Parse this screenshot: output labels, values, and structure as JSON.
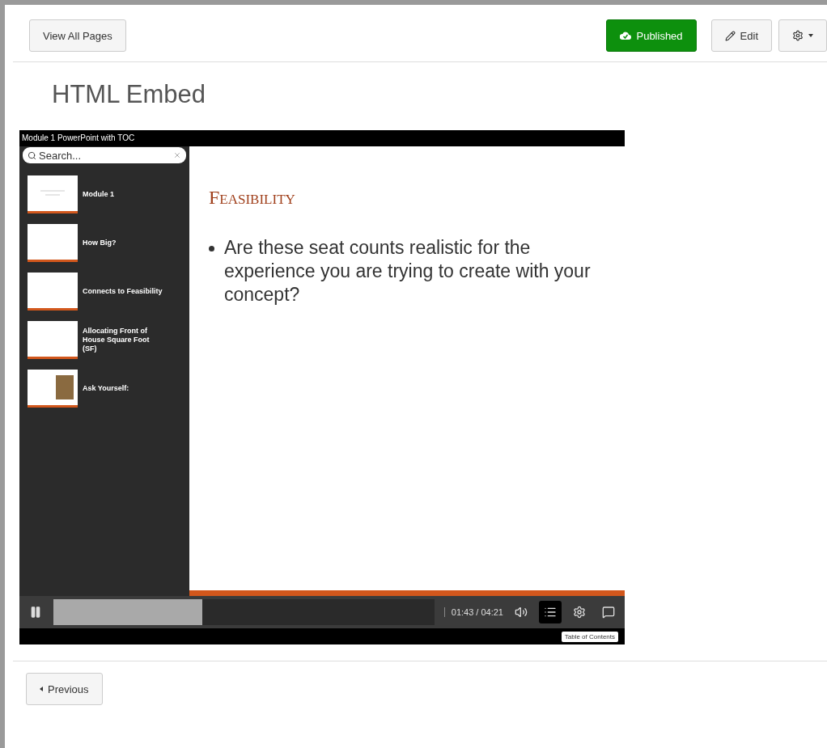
{
  "toolbar": {
    "view_all": "View All Pages",
    "published": "Published",
    "edit": "Edit"
  },
  "page_title": "HTML Embed",
  "player": {
    "title": "Module 1 PowerPoint with TOC",
    "search": {
      "placeholder": "Search..."
    },
    "toc": [
      {
        "label": "Module 1",
        "kind": "lines"
      },
      {
        "label": "How Big?",
        "kind": "blank"
      },
      {
        "label": "Connects to Feasibility",
        "kind": "blank"
      },
      {
        "label": "Allocating Front of House Square Foot (SF)",
        "kind": "blank"
      },
      {
        "label": "Ask Yourself:",
        "kind": "photo"
      }
    ],
    "slide": {
      "heading": "Feasibility",
      "bullet": "Are these seat counts realistic for the experience you are trying to create with your concept?"
    },
    "playing": true,
    "progress": {
      "level": 0.39
    },
    "time": "01:43 / 04:21",
    "controls": [
      {
        "kind": "volume",
        "selected": false
      },
      {
        "kind": "toc",
        "selected": true
      },
      {
        "kind": "settings",
        "selected": false
      },
      {
        "kind": "captions",
        "selected": false
      }
    ],
    "tooltip": "Table of Contents"
  },
  "nav": {
    "previous": "Previous"
  }
}
